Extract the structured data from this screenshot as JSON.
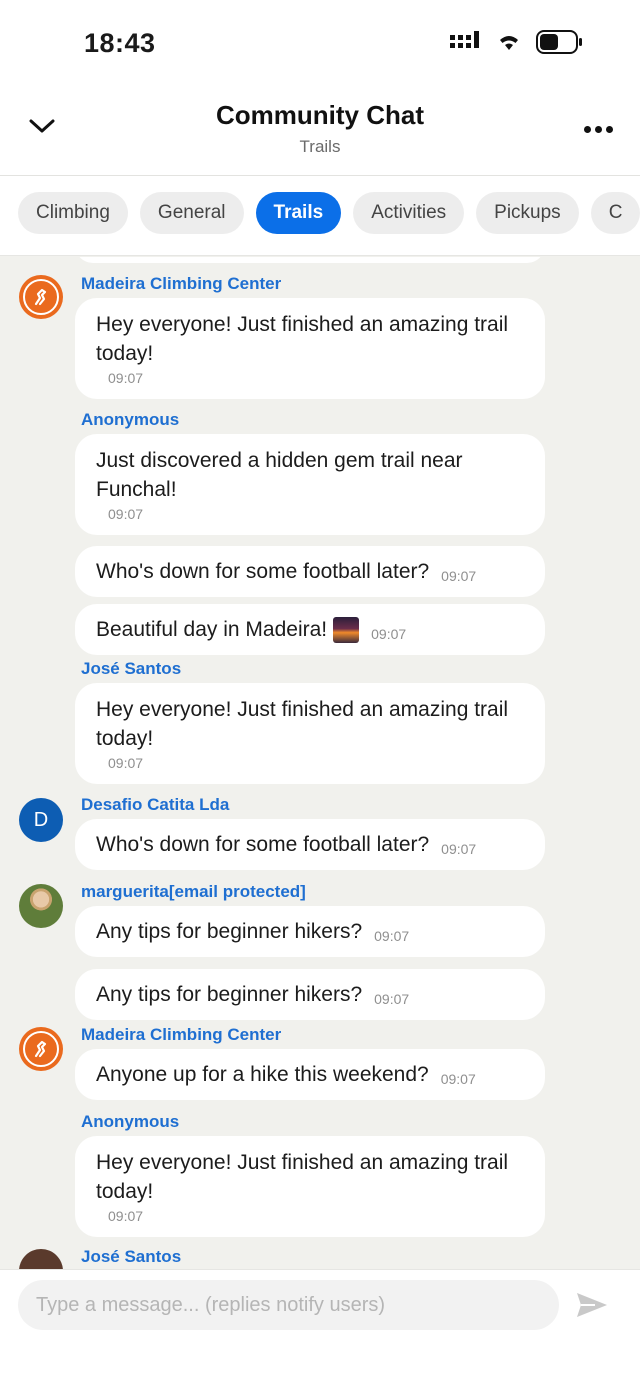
{
  "status": {
    "time": "18:43"
  },
  "header": {
    "title": "Community Chat",
    "subtitle": "Trails"
  },
  "tabs": [
    {
      "label": "Climbing",
      "active": false
    },
    {
      "label": "General",
      "active": false
    },
    {
      "label": "Trails",
      "active": true
    },
    {
      "label": "Activities",
      "active": false
    },
    {
      "label": "Pickups",
      "active": false
    },
    {
      "label": "C",
      "active": false
    }
  ],
  "messages": [
    {
      "sender": "Madeira Climbing Center",
      "text": "Hey everyone! Just finished an amazing trail today!",
      "time": "09:07"
    },
    {
      "sender": "Anonymous",
      "text": "Just discovered a hidden gem trail near Funchal!",
      "time": "09:07"
    },
    {
      "text": "Who's down for some football later?",
      "time": "09:07"
    },
    {
      "text": "Beautiful day in Madeira!",
      "time": "09:07"
    },
    {
      "sender": "José Santos",
      "text": "Hey everyone! Just finished an amazing trail today!",
      "time": "09:07"
    },
    {
      "sender": "Desafio Catita Lda",
      "avatar_letter": "D",
      "text": "Who's down for some football later?",
      "time": "09:07"
    },
    {
      "sender": "marguerita[email protected]",
      "text": "Any tips for beginner hikers?",
      "time": "09:07"
    },
    {
      "text": "Any tips for beginner hikers?",
      "time": "09:07"
    },
    {
      "sender": "Madeira Climbing Center",
      "text": "Anyone up for a hike this weekend?",
      "time": "09:07"
    },
    {
      "sender": "Anonymous",
      "text": "Hey everyone! Just finished an amazing trail today!",
      "time": "09:07"
    },
    {
      "sender": "José Santos"
    }
  ],
  "composer": {
    "placeholder": "Type a message... (replies notify users)"
  },
  "colors": {
    "accent": "#0b6fe8",
    "sender_name": "#1f6fd1",
    "background": "#f1f1ed",
    "logo_orange": "#ea6a1e",
    "avatar_blue": "#0d5db3"
  },
  "icons": [
    "chevron-down-icon",
    "more-icon",
    "signal-icon",
    "wifi-icon",
    "battery-icon",
    "send-icon",
    "lizard-logo-icon",
    "sunset-emoji"
  ]
}
